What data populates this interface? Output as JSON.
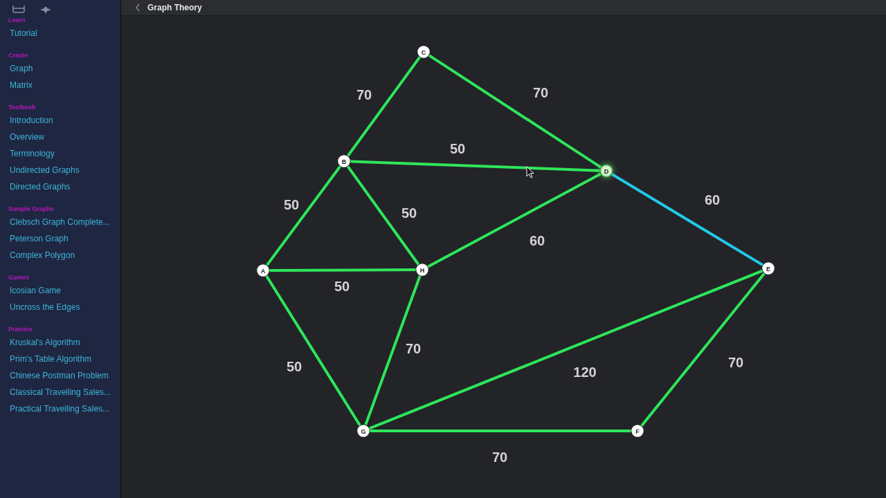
{
  "header": {
    "title": "Graph Theory"
  },
  "sidebar": {
    "sections": [
      {
        "heading": "Learn",
        "items": [
          {
            "label": "Tutorial"
          }
        ]
      },
      {
        "heading": "Create",
        "items": [
          {
            "label": "Graph"
          },
          {
            "label": "Matrix"
          }
        ]
      },
      {
        "heading": "Textbook",
        "items": [
          {
            "label": "Introduction"
          },
          {
            "label": "Overview"
          },
          {
            "label": "Terminology"
          },
          {
            "label": "Undirected Graphs"
          },
          {
            "label": "Directed Graphs"
          }
        ]
      },
      {
        "heading": "Sample Graphs",
        "items": [
          {
            "label": "Clebsch Graph Complete..."
          },
          {
            "label": "Peterson Graph"
          },
          {
            "label": "Complex Polygon"
          }
        ]
      },
      {
        "heading": "Games",
        "items": [
          {
            "label": "Icosian Game"
          },
          {
            "label": "Uncross the Edges"
          }
        ]
      },
      {
        "heading": "Practice",
        "items": [
          {
            "label": "Kruskal's Algorithm"
          },
          {
            "label": "Prim's Table Algorithm"
          },
          {
            "label": "Chinese Postman Problem"
          },
          {
            "label": "Classical Travelling Sales..."
          },
          {
            "label": "Practical Travelling Sales..."
          }
        ]
      }
    ]
  },
  "graph": {
    "nodes": [
      {
        "label": "A",
        "selected": false
      },
      {
        "label": "B",
        "selected": false
      },
      {
        "label": "C",
        "selected": false
      },
      {
        "label": "D",
        "selected": true
      },
      {
        "label": "E",
        "selected": false
      },
      {
        "label": "F",
        "selected": false
      },
      {
        "label": "G",
        "selected": false
      },
      {
        "label": "H",
        "selected": false
      }
    ],
    "edges": [
      {
        "weight": "70",
        "color": "#2ee65a"
      },
      {
        "weight": "70",
        "color": "#2ee65a"
      },
      {
        "weight": "50",
        "color": "#2ee65a"
      },
      {
        "weight": "50",
        "color": "#2ee65a"
      },
      {
        "weight": "50",
        "color": "#2ee65a"
      },
      {
        "weight": "60",
        "color": "#2ee65a"
      },
      {
        "weight": "60",
        "color": "#22c8e8"
      },
      {
        "weight": "50",
        "color": "#2ee65a"
      },
      {
        "weight": "50",
        "color": "#2ee65a"
      },
      {
        "weight": "70",
        "color": "#2ee65a"
      },
      {
        "weight": "120",
        "color": "#2ee65a"
      },
      {
        "weight": "70",
        "color": "#2ee65a"
      },
      {
        "weight": "70",
        "color": "#2ee65a"
      }
    ]
  }
}
